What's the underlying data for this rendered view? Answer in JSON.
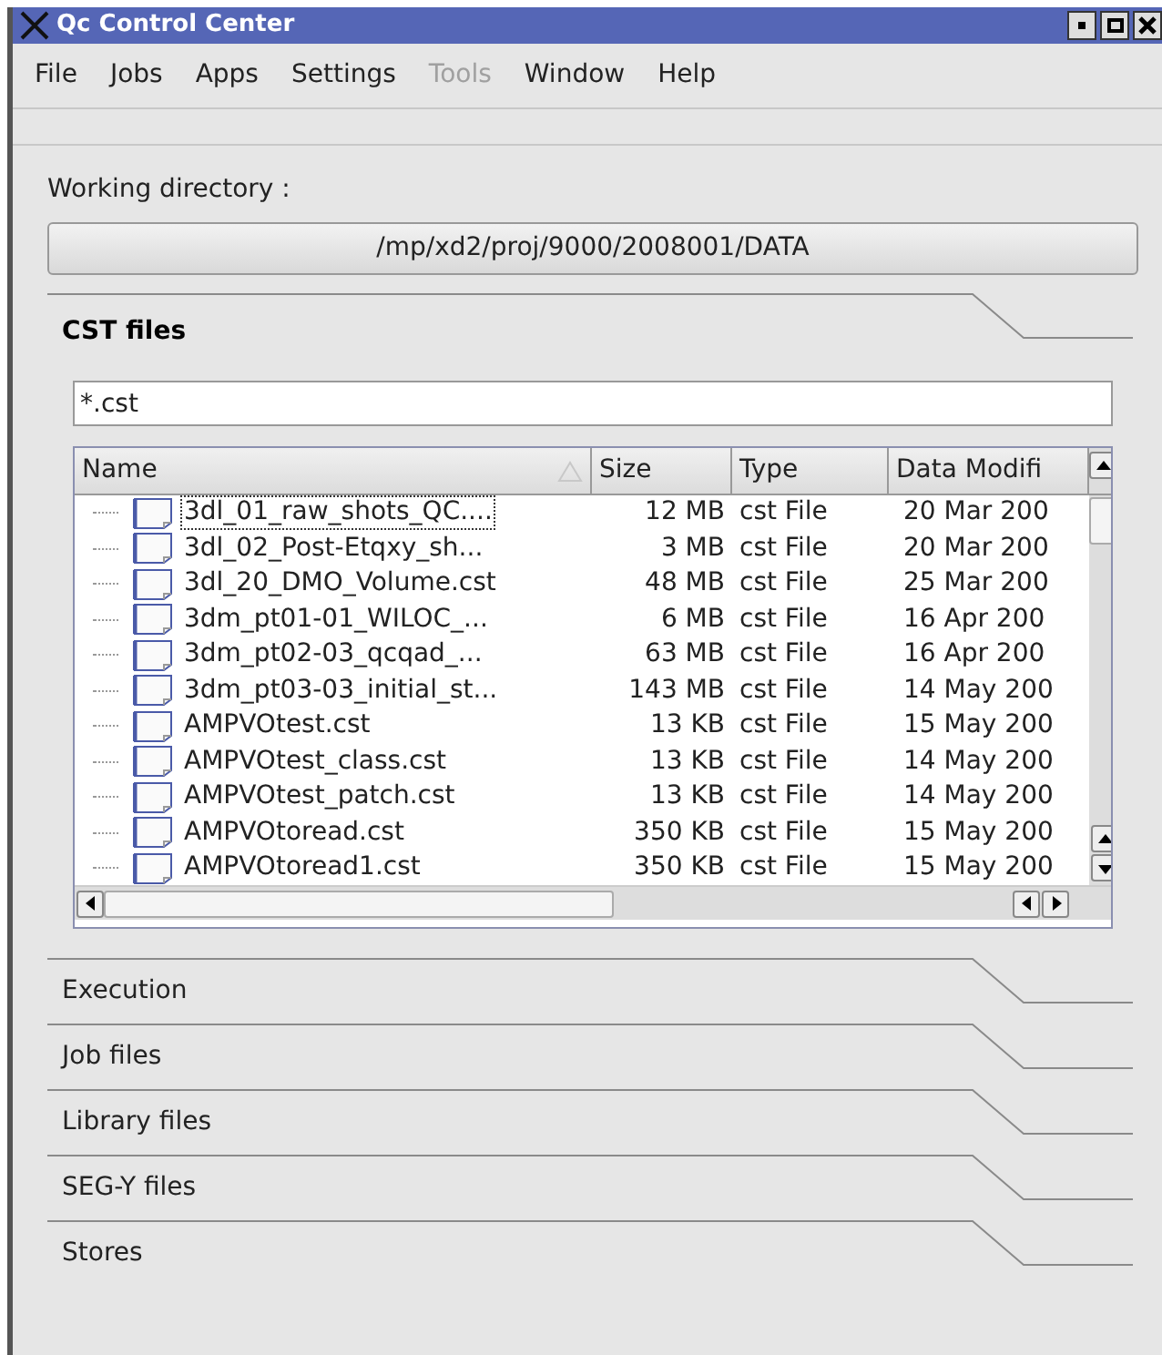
{
  "window": {
    "title": "Qc Control Center"
  },
  "menu": [
    {
      "label": "File",
      "disabled": false
    },
    {
      "label": "Jobs",
      "disabled": false
    },
    {
      "label": "Apps",
      "disabled": false
    },
    {
      "label": "Settings",
      "disabled": false
    },
    {
      "label": "Tools",
      "disabled": true
    },
    {
      "label": "Window",
      "disabled": false
    },
    {
      "label": "Help",
      "disabled": false
    }
  ],
  "working_directory": {
    "label": "Working directory :",
    "path": "/mp/xd2/proj/9000/2008001/DATA"
  },
  "sections": [
    {
      "title": "CST files",
      "expanded": true
    },
    {
      "title": "Execution",
      "expanded": false
    },
    {
      "title": "Job files",
      "expanded": false
    },
    {
      "title": "Library files",
      "expanded": false
    },
    {
      "title": "SEG-Y files",
      "expanded": false
    },
    {
      "title": "Stores",
      "expanded": false
    }
  ],
  "filter": {
    "value": "*.cst"
  },
  "table": {
    "columns": [
      "Name",
      "Size",
      "Type",
      "Data Modifi"
    ],
    "rows": [
      {
        "name": "3dl_01_raw_shots_QC....",
        "size": "12 MB",
        "type": "cst File",
        "date": "20 Mar 200",
        "focused": true
      },
      {
        "name": "3dl_02_Post-Etqxy_sh...",
        "size": "3 MB",
        "type": "cst File",
        "date": "20 Mar 200",
        "focused": false
      },
      {
        "name": "3dl_20_DMO_Volume.cst",
        "size": "48 MB",
        "type": "cst File",
        "date": "25 Mar 200",
        "focused": false
      },
      {
        "name": "3dm_pt01-01_WILOC_...",
        "size": "6 MB",
        "type": "cst File",
        "date": "16 Apr 200",
        "focused": false
      },
      {
        "name": "3dm_pt02-03_qcqad_...",
        "size": "63 MB",
        "type": "cst File",
        "date": "16 Apr 200",
        "focused": false
      },
      {
        "name": "3dm_pt03-03_initial_st...",
        "size": "143 MB",
        "type": "cst File",
        "date": "14 May 200",
        "focused": false
      },
      {
        "name": "AMPVOtest.cst",
        "size": "13 KB",
        "type": "cst File",
        "date": "15 May 200",
        "focused": false
      },
      {
        "name": "AMPVOtest_class.cst",
        "size": "13 KB",
        "type": "cst File",
        "date": "14 May 200",
        "focused": false
      },
      {
        "name": "AMPVOtest_patch.cst",
        "size": "13 KB",
        "type": "cst File",
        "date": "14 May 200",
        "focused": false
      },
      {
        "name": "AMPVOtoread.cst",
        "size": "350 KB",
        "type": "cst File",
        "date": "15 May 200",
        "focused": false
      },
      {
        "name": "AMPVOtoread1.cst",
        "size": "350 KB",
        "type": "cst File",
        "date": "15 May 200",
        "focused": false
      }
    ]
  }
}
